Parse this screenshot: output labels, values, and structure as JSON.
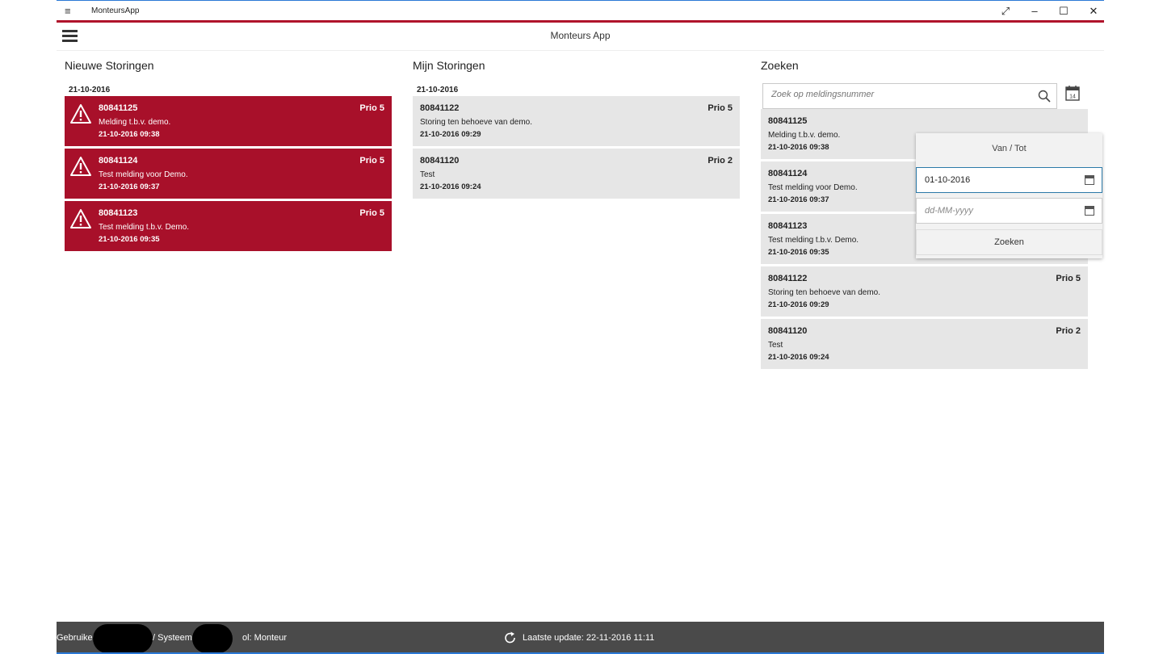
{
  "window": {
    "title": "MonteursApp",
    "menu_icon": "≡",
    "controls": [
      "⤢",
      "–",
      "☐",
      "✕"
    ]
  },
  "header": {
    "title": "Monteurs App"
  },
  "colors": {
    "accent_red": "#a8102a",
    "card_grey": "#e6e6e6",
    "status_bar": "#4a4a4a"
  },
  "nieuwe": {
    "title": "Nieuwe Storingen",
    "date": "21-10-2016",
    "items": [
      {
        "num": "80841125",
        "desc": "Melding t.b.v. demo.",
        "dt": "21-10-2016 09:38",
        "prio": "Prio 5"
      },
      {
        "num": "80841124",
        "desc": "Test melding voor Demo.",
        "dt": "21-10-2016 09:37",
        "prio": "Prio 5"
      },
      {
        "num": "80841123",
        "desc": "Test melding t.b.v. Demo.",
        "dt": "21-10-2016 09:35",
        "prio": "Prio 5"
      }
    ]
  },
  "mijn": {
    "title": "Mijn Storingen",
    "date": "21-10-2016",
    "items": [
      {
        "num": "80841122",
        "desc": "Storing ten behoeve van demo.",
        "dt": "21-10-2016 09:29",
        "prio": "Prio 5"
      },
      {
        "num": "80841120",
        "desc": "Test",
        "dt": "21-10-2016 09:24",
        "prio": "Prio 2"
      }
    ]
  },
  "zoeken": {
    "title": "Zoeken",
    "placeholder": "Zoek op meldingsnummer",
    "items": [
      {
        "num": "80841125",
        "desc": "Melding t.b.v. demo.",
        "dt": "21-10-2016 09:38",
        "prio": ""
      },
      {
        "num": "80841124",
        "desc": "Test melding voor Demo.",
        "dt": "21-10-2016 09:37",
        "prio": ""
      },
      {
        "num": "80841123",
        "desc": "Test melding t.b.v. Demo.",
        "dt": "21-10-2016 09:35",
        "prio": ""
      },
      {
        "num": "80841122",
        "desc": "Storing ten behoeve van demo.",
        "dt": "21-10-2016 09:29",
        "prio": "Prio 5"
      },
      {
        "num": "80841120",
        "desc": "Test",
        "dt": "21-10-2016 09:24",
        "prio": "Prio 2"
      }
    ]
  },
  "datepicker": {
    "title": "Van / Tot",
    "from_value": "01-10-2016",
    "to_placeholder": "dd-MM-yyyy",
    "button": "Zoeken"
  },
  "status": {
    "user_label": "Gebruiker",
    "system_label": "/ Systeem",
    "role_text": "ol: Monteur",
    "update_text": "Laatste update: 22-11-2016 11:11"
  }
}
